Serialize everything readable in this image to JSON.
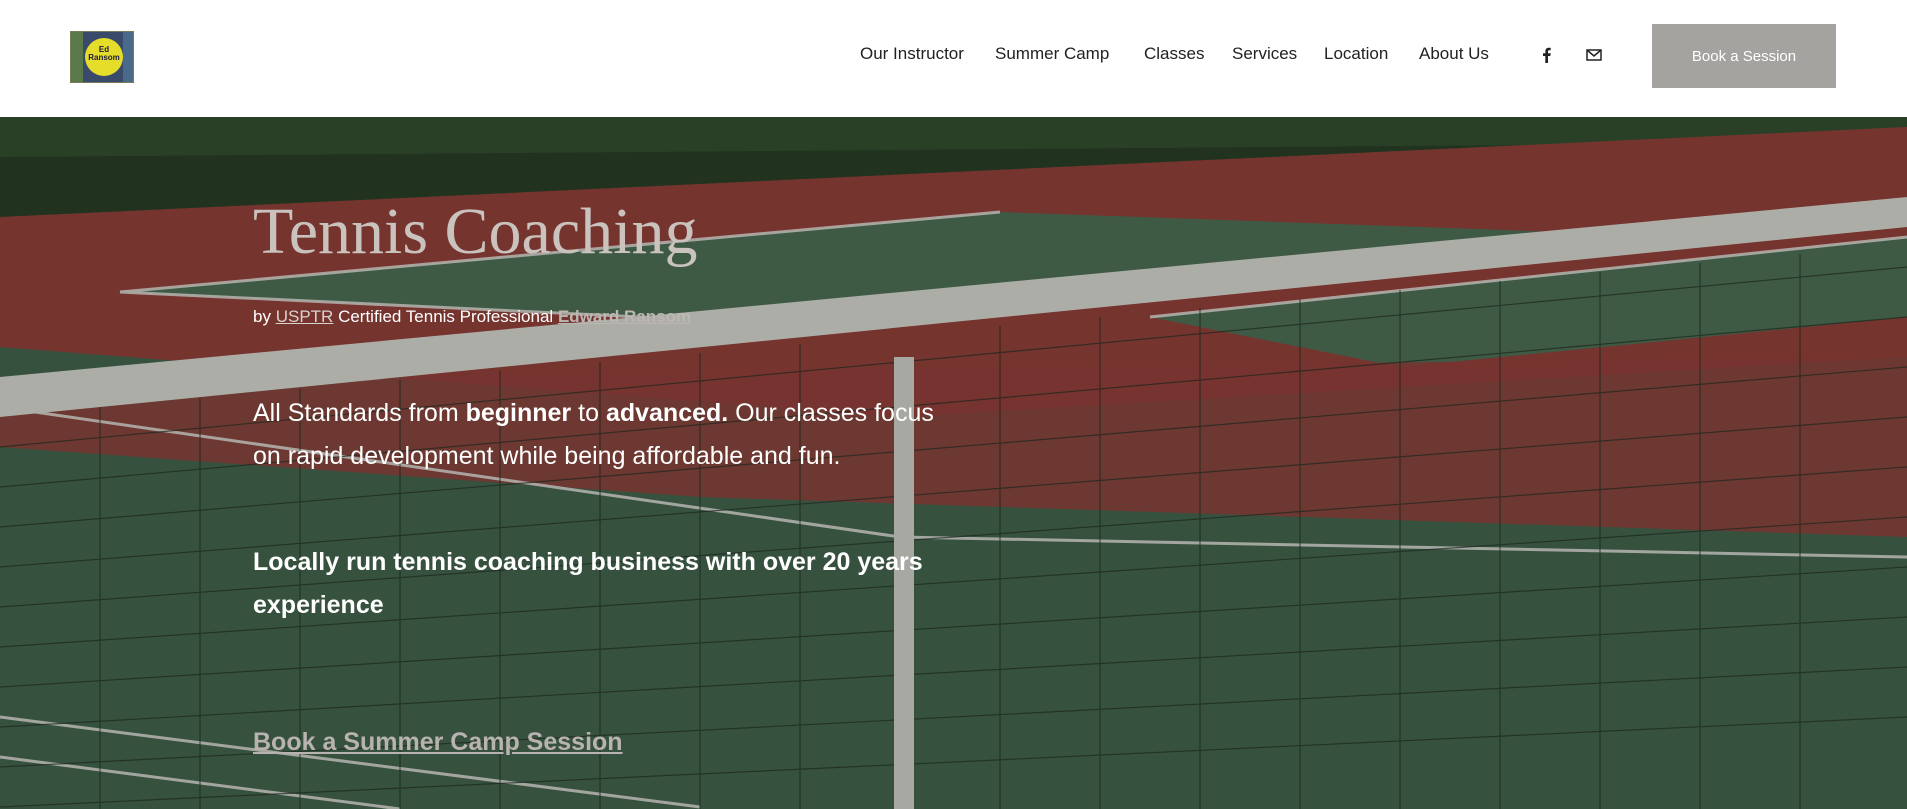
{
  "logo": {
    "text": "Ed Ransom"
  },
  "nav": {
    "items": [
      "Our Instructor",
      "Summer Camp",
      "Classes",
      "Services",
      "Location",
      "About Us"
    ]
  },
  "social": {
    "facebook_icon": "facebook-icon",
    "email_icon": "mail-icon"
  },
  "header": {
    "book_label": "Book a Session"
  },
  "hero": {
    "title": "Tennis Coaching",
    "sub_by": "by",
    "sub_org": "USPTR",
    "sub_mid": "Certified Tennis Professional",
    "sub_name": "Edward Ransom",
    "para_1": "All Standards from",
    "para_b1": "beginner",
    "para_2": "to",
    "para_b2": "advanced.",
    "para_3": "Our classes focus on rapid development while being affordable and fun.",
    "bold_line": "Locally run tennis coaching business with over 20 years experience",
    "cta": "Book a Summer Camp Session"
  },
  "colors": {
    "button": "#a5a39f",
    "court_red": "#8a3a34",
    "court_green": "#3d5c47"
  }
}
